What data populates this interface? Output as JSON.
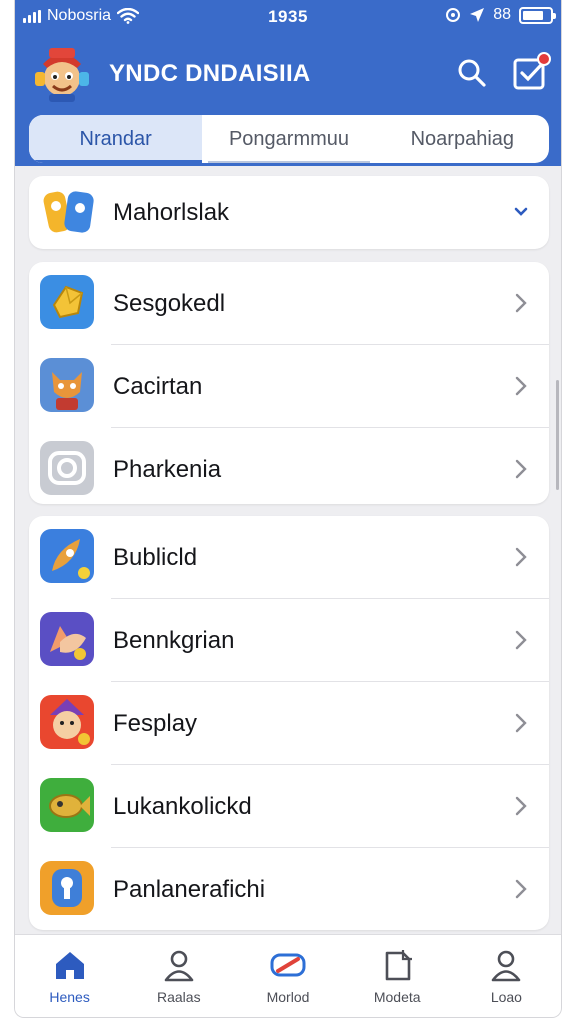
{
  "status_bar": {
    "carrier": "Nobosria",
    "time": "1935",
    "battery_text": "88"
  },
  "app_bar": {
    "title": "YNDC DNDAISIIA",
    "logo_icon": "mascot-logo-icon",
    "search_icon": "search-icon",
    "notify_icon": "notification-check-icon"
  },
  "tabs": [
    {
      "label": "Nrandar",
      "active": true
    },
    {
      "label": "Pongarmmuu",
      "active": false
    },
    {
      "label": "Noarpahiag",
      "active": false
    }
  ],
  "dropdown_card": {
    "label": "Mahorlslak",
    "icon": "game-badge-icon"
  },
  "group1": [
    {
      "label": "Sesgokedl",
      "icon": "gold-crystal-icon"
    },
    {
      "label": "Cacirtan",
      "icon": "fox-character-icon"
    },
    {
      "label": "Pharkenia",
      "icon": "camera-icon"
    }
  ],
  "group2": [
    {
      "label": "Bublicld",
      "icon": "rocket-icon"
    },
    {
      "label": "Bennkgrian",
      "icon": "bird-icon"
    },
    {
      "label": "Fesplay",
      "icon": "wizard-character-icon"
    },
    {
      "label": "Lukankolickd",
      "icon": "robot-fish-icon"
    },
    {
      "label": "Panlanerafichi",
      "icon": "keyhole-icon"
    }
  ],
  "bottom_nav": [
    {
      "label": "Henes",
      "icon": "home-icon",
      "active": true
    },
    {
      "label": "Raalas",
      "icon": "person-icon",
      "active": false
    },
    {
      "label": "Morlod",
      "icon": "brand-logo-icon",
      "active": false
    },
    {
      "label": "Modeta",
      "icon": "document-icon",
      "active": false
    },
    {
      "label": "Loao",
      "icon": "profile-icon",
      "active": false
    }
  ],
  "colors": {
    "header": "#3a6bc9",
    "accent": "#2d5bbf",
    "background": "#eeeef1"
  }
}
